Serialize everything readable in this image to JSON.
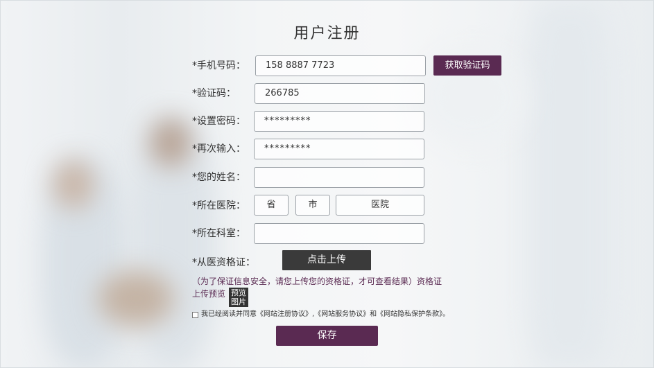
{
  "page": {
    "title": "用户注册"
  },
  "form": {
    "phone": {
      "label": "*手机号码：",
      "value": "158 8887 7723"
    },
    "get_code_button": "获取验证码",
    "code": {
      "label": "*验证码：",
      "value": "266785"
    },
    "password": {
      "label": "*设置密码：",
      "value": "*********"
    },
    "password_confirm": {
      "label": "*再次输入：",
      "value": "*********"
    },
    "name": {
      "label": "*您的姓名：",
      "value": ""
    },
    "hospital": {
      "label": "*所在医院：",
      "province": "省",
      "city": "市",
      "hospital": "医院"
    },
    "department": {
      "label": "*所在科室：",
      "value": ""
    },
    "certificate": {
      "label": "*从医资格证：",
      "upload_button": "点击上传"
    },
    "notice_line1": "（为了保证信息安全，请您上传您的资格证，才可查看结果）资格证",
    "notice_line2": "上传预览",
    "preview_button_line1": "预览",
    "preview_button_line2": "图片",
    "agreement_text": "我已经阅读并同意《网站注册协议》,《网站服务协议》和《网站隐私保护条款》。",
    "agreement_checked": false,
    "save_button": "保存"
  },
  "colors": {
    "accent": "#5a2a52",
    "dark_button": "#3a3a3a"
  }
}
